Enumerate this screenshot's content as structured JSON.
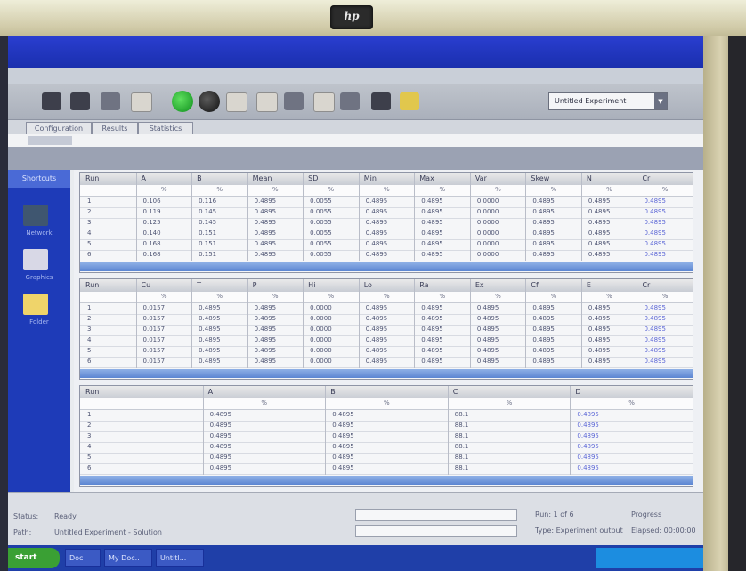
{
  "brand": {
    "logo_text": "hp"
  },
  "toolbar": {
    "dropdown_value": "Untitled Experiment",
    "dropdown_arrow_icon": "chevron-down-icon"
  },
  "tabs": [
    "Configuration",
    "Results",
    "Statistics"
  ],
  "sidebar": {
    "header": "Shortcuts",
    "items": [
      {
        "icon": "network-icon",
        "label": "Network"
      },
      {
        "icon": "image-icon",
        "label": "Graphics"
      },
      {
        "icon": "folder-icon",
        "label": "Folder"
      }
    ]
  },
  "grid1": {
    "headers": [
      "Run",
      "A",
      "B",
      "Mean",
      "SD",
      "Min",
      "Max",
      "Var",
      "Skew",
      "N",
      "Cr"
    ],
    "subheaders": [
      "",
      "%",
      "%",
      "%",
      "%",
      "%",
      "%",
      "%",
      "%",
      "%",
      "%"
    ],
    "rows": [
      [
        "1",
        "0.106",
        "0.116",
        "0.4895",
        "0.0055",
        "0.4895",
        "0.4895",
        "0.0000",
        "0.4895",
        "0.4895",
        "0.4895"
      ],
      [
        "2",
        "0.119",
        "0.145",
        "0.4895",
        "0.0055",
        "0.4895",
        "0.4895",
        "0.0000",
        "0.4895",
        "0.4895",
        "0.4895"
      ],
      [
        "3",
        "0.125",
        "0.145",
        "0.4895",
        "0.0055",
        "0.4895",
        "0.4895",
        "0.0000",
        "0.4895",
        "0.4895",
        "0.4895"
      ],
      [
        "4",
        "0.140",
        "0.151",
        "0.4895",
        "0.0055",
        "0.4895",
        "0.4895",
        "0.0000",
        "0.4895",
        "0.4895",
        "0.4895"
      ],
      [
        "5",
        "0.168",
        "0.151",
        "0.4895",
        "0.0055",
        "0.4895",
        "0.4895",
        "0.0000",
        "0.4895",
        "0.4895",
        "0.4895"
      ],
      [
        "6",
        "0.168",
        "0.151",
        "0.4895",
        "0.0055",
        "0.4895",
        "0.4895",
        "0.0000",
        "0.4895",
        "0.4895",
        "0.4895"
      ]
    ]
  },
  "grid2": {
    "headers": [
      "Run",
      "Cu",
      "T",
      "P",
      "Hi",
      "Lo",
      "Ra",
      "Ex",
      "Cf",
      "E",
      "Cr"
    ],
    "subheaders": [
      "",
      "%",
      "%",
      "%",
      "%",
      "%",
      "%",
      "%",
      "%",
      "%",
      "%"
    ],
    "rows": [
      [
        "1",
        "0.0157",
        "0.4895",
        "0.4895",
        "0.0000",
        "0.4895",
        "0.4895",
        "0.4895",
        "0.4895",
        "0.4895",
        "0.4895"
      ],
      [
        "2",
        "0.0157",
        "0.4895",
        "0.4895",
        "0.0000",
        "0.4895",
        "0.4895",
        "0.4895",
        "0.4895",
        "0.4895",
        "0.4895"
      ],
      [
        "3",
        "0.0157",
        "0.4895",
        "0.4895",
        "0.0000",
        "0.4895",
        "0.4895",
        "0.4895",
        "0.4895",
        "0.4895",
        "0.4895"
      ],
      [
        "4",
        "0.0157",
        "0.4895",
        "0.4895",
        "0.0000",
        "0.4895",
        "0.4895",
        "0.4895",
        "0.4895",
        "0.4895",
        "0.4895"
      ],
      [
        "5",
        "0.0157",
        "0.4895",
        "0.4895",
        "0.0000",
        "0.4895",
        "0.4895",
        "0.4895",
        "0.4895",
        "0.4895",
        "0.4895"
      ],
      [
        "6",
        "0.0157",
        "0.4895",
        "0.4895",
        "0.0000",
        "0.4895",
        "0.4895",
        "0.4895",
        "0.4895",
        "0.4895",
        "0.4895"
      ]
    ]
  },
  "grid3": {
    "headers": [
      "Run",
      "A",
      "B",
      "C",
      "D"
    ],
    "subheaders": [
      "",
      "%",
      "%",
      "%",
      "%"
    ],
    "rows": [
      [
        "1",
        "0.4895",
        "0.4895",
        "88.1",
        "0.4895"
      ],
      [
        "2",
        "0.4895",
        "0.4895",
        "88.1",
        "0.4895"
      ],
      [
        "3",
        "0.4895",
        "0.4895",
        "88.1",
        "0.4895"
      ],
      [
        "4",
        "0.4895",
        "0.4895",
        "88.1",
        "0.4895"
      ],
      [
        "5",
        "0.4895",
        "0.4895",
        "88.1",
        "0.4895"
      ],
      [
        "6",
        "0.4895",
        "0.4895",
        "88.1",
        "0.4895"
      ]
    ]
  },
  "status": {
    "label1": "Status:",
    "value1": "Ready",
    "label2": "Path:",
    "value2": "Untitled Experiment - Solution",
    "label3": "Run: 1 of 6",
    "label4": "Type: Experiment output",
    "label5": "Progress",
    "label6": "Elapsed: 00:00:00"
  },
  "taskbar": {
    "start_label": "start",
    "buttons": [
      "Doc",
      "My Doc..",
      "Untitl..."
    ]
  }
}
